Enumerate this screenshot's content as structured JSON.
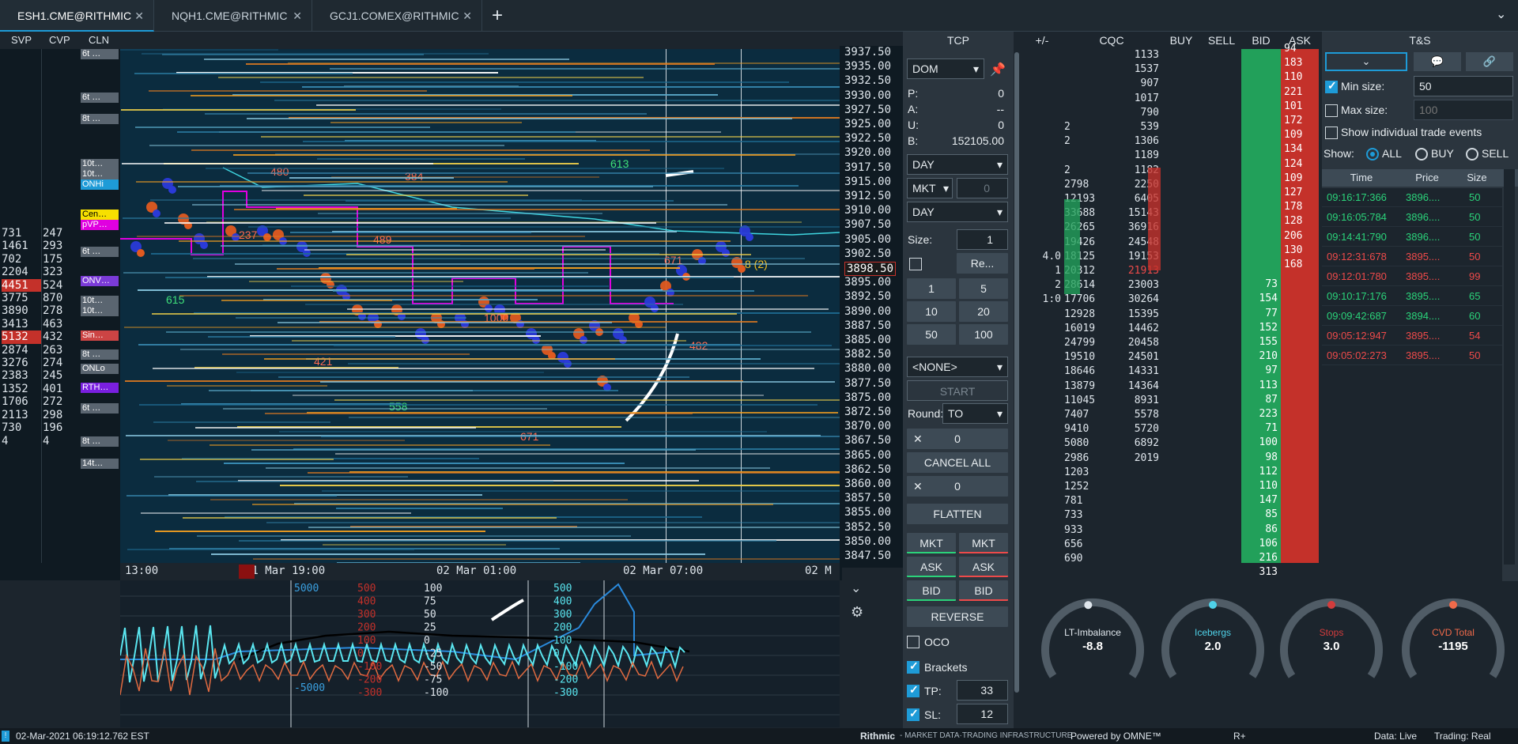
{
  "tabs": [
    {
      "label": "ESH1.CME@RITHMIC",
      "active": true
    },
    {
      "label": "NQH1.CME@RITHMIC",
      "active": false
    },
    {
      "label": "GCJ1.COMEX@RITHMIC",
      "active": false
    }
  ],
  "toolbar": {
    "svp": "SVP",
    "cvp": "CVP",
    "cln": "CLN"
  },
  "left_profile": {
    "col1": [
      "731",
      "1461",
      "702",
      "2204",
      "4451",
      "3775",
      "3890",
      "3413",
      "5132",
      "2874",
      "3276",
      "2383",
      "1352",
      "1706",
      "2113",
      "730",
      "4"
    ],
    "col2": [
      "247",
      "293",
      "175",
      "323",
      "524",
      "870",
      "278",
      "463",
      "432",
      "263",
      "274",
      "245",
      "401",
      "272",
      "298",
      "196",
      "4"
    ]
  },
  "level_tags": [
    "6t …",
    "6t …",
    "8t …",
    "10t…",
    "10t…",
    "ONHi",
    "Cen…",
    "pVP…",
    "6t …",
    "ONV…",
    "10t…",
    "10t…",
    "Sin…",
    "8t …",
    "ONLo",
    "RTH…",
    "6t …",
    "8t …",
    "14t…"
  ],
  "chart_labels": [
    "480",
    "237",
    "489",
    "384",
    "1000",
    "613",
    "421",
    "558",
    "671",
    "671",
    "482",
    "615",
    "8 (2)"
  ],
  "price_axis": [
    "3937.50",
    "3935.00",
    "3932.50",
    "3930.00",
    "3927.50",
    "3925.00",
    "3922.50",
    "3920.00",
    "3917.50",
    "3915.00",
    "3912.50",
    "3910.00",
    "3907.50",
    "3905.00",
    "3902.50",
    "3898.50",
    "3895.00",
    "3892.50",
    "3890.00",
    "3887.50",
    "3885.00",
    "3882.50",
    "3880.00",
    "3877.50",
    "3875.00",
    "3872.50",
    "3870.00",
    "3867.50",
    "3865.00",
    "3862.50",
    "3860.00",
    "3857.50",
    "3855.00",
    "3852.50",
    "3850.00",
    "3847.50"
  ],
  "current_price": "3898.50",
  "time_axis": [
    "13:00",
    "01 Mar 19:00",
    "02 Mar 01:00",
    "02 Mar 07:00",
    "02 M"
  ],
  "sub_axis": {
    "blue": [
      "5000",
      "-5000"
    ],
    "red": [
      "500",
      "400",
      "300",
      "200",
      "100",
      "0",
      "-100",
      "-200",
      "-300"
    ],
    "white": [
      "100",
      "75",
      "50",
      "25",
      "0",
      "-25",
      "-50",
      "-75",
      "-100"
    ],
    "cyan": [
      "500",
      "400",
      "300",
      "200",
      "100",
      "0",
      "-100",
      "-200",
      "-300"
    ]
  },
  "tcp": {
    "title": "TCP",
    "mode": "DOM",
    "p_label": "P:",
    "p_val": "0",
    "a_label": "A:",
    "a_val": "--",
    "u_label": "U:",
    "u_val": "0",
    "b_label": "B:",
    "b_val": "152105.00",
    "tif1": "DAY",
    "order_type": "MKT",
    "order_qty": "0",
    "tif2": "DAY",
    "size_label": "Size:",
    "size_val": "1",
    "reset": "Re...",
    "qty_buttons": [
      "1",
      "5",
      "10",
      "20",
      "50",
      "100"
    ],
    "strategy": "<NONE>",
    "start": "START",
    "round_label": "Round:",
    "round_val": "TO",
    "x1": "0",
    "cancel_all": "CANCEL ALL",
    "x2": "0",
    "flatten": "FLATTEN",
    "mkt": "MKT",
    "ask": "ASK",
    "bid": "BID",
    "reverse": "REVERSE",
    "oco": "OCO",
    "brackets": "Brackets",
    "tp_label": "TP:",
    "tp_val": "33",
    "sl_label": "SL:",
    "sl_val": "12"
  },
  "dom": {
    "headers": [
      "+/-",
      "CQC",
      "BUY",
      "SELL",
      "BID",
      "ASK"
    ],
    "pm": [
      "",
      "",
      "",
      "",
      "",
      "",
      "",
      "",
      "",
      "",
      "",
      "",
      "",
      "",
      "4.0",
      "1",
      "2",
      "1:0"
    ],
    "cqc_left": [
      "",
      "",
      "",
      "",
      "",
      "2",
      "2",
      "",
      "2",
      "2798",
      "12193",
      "33688",
      "26265",
      "19426",
      "18125",
      "20312",
      "28614",
      "17706",
      "12928",
      "16019",
      "24799",
      "19510",
      "18646",
      "13879",
      "11045",
      "7407",
      "9410",
      "5080",
      "2986",
      "1203",
      "1252",
      "781",
      "733",
      "933",
      "656",
      "690"
    ],
    "cqc_right": [
      "1133",
      "1537",
      "907",
      "1017",
      "790",
      "539",
      "1306",
      "1189",
      "1182",
      "2250",
      "6405",
      "15143",
      "36916",
      "24548",
      "19153",
      "21913",
      "23003",
      "30264",
      "15395",
      "14462",
      "20458",
      "24501",
      "14331",
      "14364",
      "8931",
      "5578",
      "5720",
      "6892",
      "2019",
      "",
      "",
      "",
      "",
      "",
      "",
      ""
    ],
    "ask": [
      "94",
      "183",
      "110",
      "221",
      "101",
      "172",
      "109",
      "134",
      "124",
      "109",
      "127",
      "178",
      "128",
      "206",
      "130",
      "168"
    ],
    "bid": [
      "73",
      "154",
      "77",
      "152",
      "155",
      "210",
      "97",
      "113",
      "87",
      "223",
      "71",
      "100",
      "98",
      "112",
      "110",
      "147",
      "85",
      "86",
      "106",
      "216",
      "313"
    ]
  },
  "ts": {
    "title": "T&S",
    "min_label": "Min size:",
    "min_val": "50",
    "max_label": "Max size:",
    "max_ph": "100",
    "show_ind": "Show individual trade events",
    "show_label": "Show:",
    "opt_all": "ALL",
    "opt_buy": "BUY",
    "opt_sell": "SELL",
    "cols": [
      "Time",
      "Price",
      "Size"
    ],
    "rows": [
      {
        "t": "09:16:17:366",
        "p": "3896....",
        "s": "50",
        "side": "buy"
      },
      {
        "t": "09:16:05:784",
        "p": "3896....",
        "s": "50",
        "side": "buy"
      },
      {
        "t": "09:14:41:790",
        "p": "3896....",
        "s": "50",
        "side": "buy"
      },
      {
        "t": "09:12:31:678",
        "p": "3895....",
        "s": "50",
        "side": "sell"
      },
      {
        "t": "09:12:01:780",
        "p": "3895....",
        "s": "99",
        "side": "sell"
      },
      {
        "t": "09:10:17:176",
        "p": "3895....",
        "s": "65",
        "side": "buy"
      },
      {
        "t": "09:09:42:687",
        "p": "3894....",
        "s": "60",
        "side": "buy"
      },
      {
        "t": "09:05:12:947",
        "p": "3895....",
        "s": "54",
        "side": "sell"
      },
      {
        "t": "09:05:02:273",
        "p": "3895....",
        "s": "50",
        "side": "sell"
      }
    ]
  },
  "gauges": [
    {
      "label": "LT-Imbalance",
      "value": "-8.8",
      "color": "#dfe6ec",
      "level": 0.48
    },
    {
      "label": "Icebergs",
      "value": "2.0",
      "color": "#4fd1e8",
      "level": 0.5
    },
    {
      "label": "Stops",
      "value": "3.0",
      "color": "#d23c3c",
      "level": 0.5
    },
    {
      "label": "CVD Total",
      "value": "-1195",
      "color": "#f06a4a",
      "level": 0.5
    }
  ],
  "status": {
    "datetime": "02-Mar-2021 06:19:12.762 EST",
    "rithmic": "Rithmic",
    "rithmic_sub": "- MARKET DATA·TRADING INFRASTRUCTURE",
    "omne": "Powered by OMNE™",
    "r": "R+",
    "data": "Data: Live",
    "trading": "Trading: Real"
  },
  "colors": {
    "buy": "#2bd37a",
    "sell": "#ee4a4a",
    "bid_bg": "#22a05a",
    "ask_bg": "#c4312a",
    "accent": "#1e9bd7"
  }
}
